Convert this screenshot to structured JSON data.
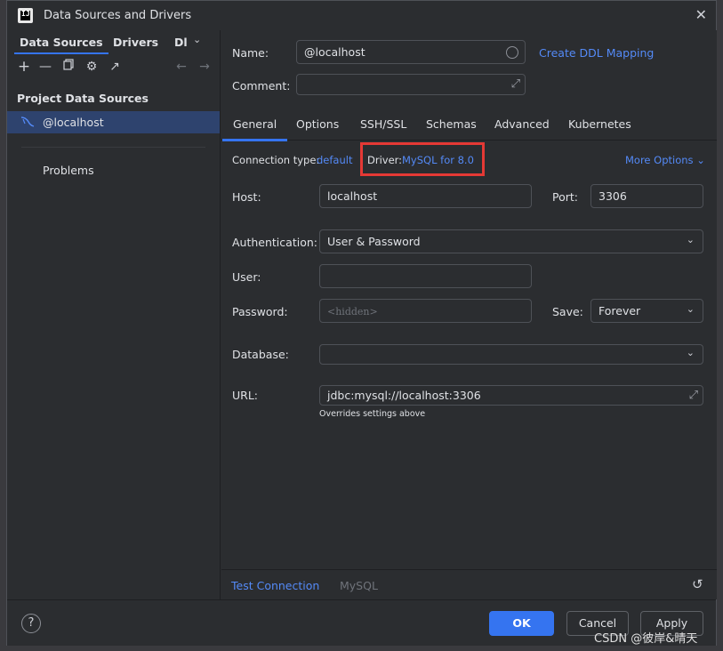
{
  "window": {
    "title": "Data Sources and Drivers"
  },
  "left": {
    "tabs": [
      "Data Sources",
      "Drivers",
      "Dl"
    ],
    "section_header": "Project Data Sources",
    "selected_item": "@localhost",
    "problems": "Problems"
  },
  "form": {
    "name_label": "Name:",
    "name_value": "@localhost",
    "create_ddl": "Create DDL Mapping",
    "comment_label": "Comment:",
    "tabs": [
      "General",
      "Options",
      "SSH/SSL",
      "Schemas",
      "Advanced",
      "Kubernetes"
    ],
    "connection_type_label": "Connection type:",
    "connection_type_value": "default",
    "driver_label": "Driver:",
    "driver_value": "MySQL for 8.0",
    "more_options": "More Options",
    "host_label": "Host:",
    "host_value": "localhost",
    "port_label": "Port:",
    "port_value": "3306",
    "auth_label": "Authentication:",
    "auth_value": "User & Password",
    "user_label": "User:",
    "user_value": "",
    "password_label": "Password:",
    "password_placeholder": "<hidden>",
    "save_label": "Save:",
    "save_value": "Forever",
    "database_label": "Database:",
    "database_value": "",
    "url_label": "URL:",
    "url_value": "jdbc:mysql://localhost:3306",
    "url_hint": "Overrides settings above"
  },
  "footer": {
    "test_connection": "Test Connection",
    "driver_name": "MySQL"
  },
  "buttons": {
    "ok": "OK",
    "cancel": "Cancel",
    "apply": "Apply"
  },
  "watermark": "CSDN @彼岸&晴天",
  "colors": {
    "accent": "#3574f0",
    "link": "#548af7",
    "highlight_box": "#e53935"
  }
}
